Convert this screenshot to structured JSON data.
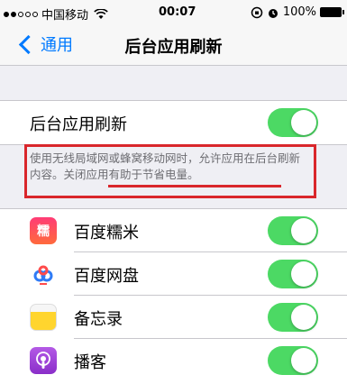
{
  "status_bar": {
    "carrier": "中国移动",
    "time": "00:07",
    "battery": "100%"
  },
  "nav": {
    "back_label": "通用",
    "title": "后台应用刷新"
  },
  "main_toggle": {
    "label": "后台应用刷新",
    "on": true
  },
  "footer": {
    "text": "使用无线局域网或蜂窝移动网时，允许应用在后台刷新内容。关闭应用有助于节省电量。"
  },
  "apps": [
    {
      "name": "百度糯米",
      "icon": "nuomi-icon",
      "icon_glyph": "糯",
      "on": true
    },
    {
      "name": "百度网盘",
      "icon": "baidu-netdisk-icon",
      "on": true
    },
    {
      "name": "备忘录",
      "icon": "notes-icon",
      "on": true
    },
    {
      "name": "播客",
      "icon": "podcasts-icon",
      "on": true
    }
  ],
  "colors": {
    "accent": "#007aff",
    "toggle_on": "#4cd964",
    "highlight": "#d9262b"
  }
}
